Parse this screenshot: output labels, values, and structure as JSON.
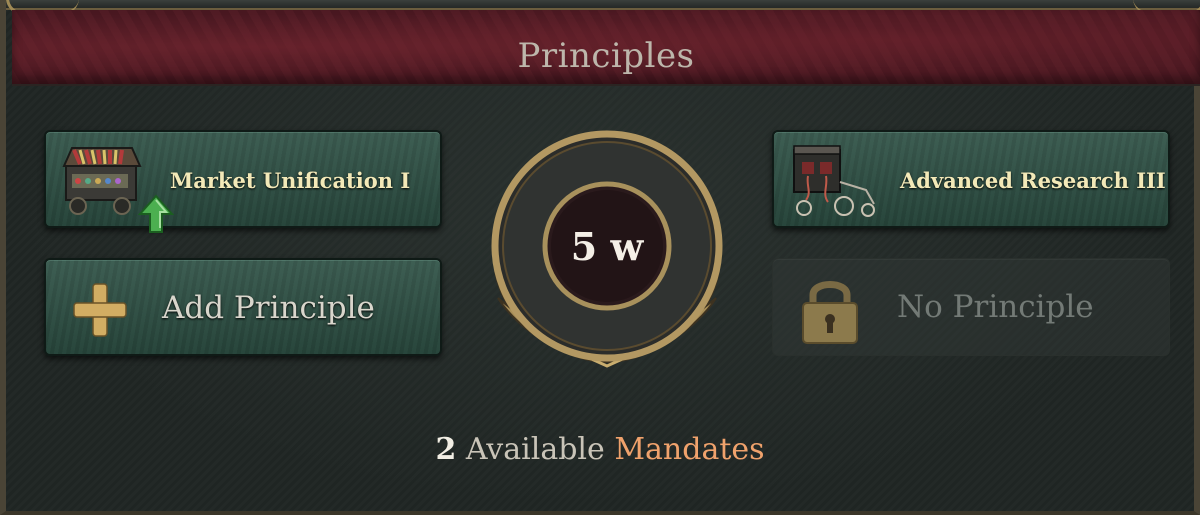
{
  "panel": {
    "title": "Principles"
  },
  "slots": {
    "market": {
      "label": "Market Unification I",
      "icon": "market-stall-icon",
      "badge": "upgrade-arrow-icon"
    },
    "research": {
      "label": "Advanced Research III",
      "icon": "research-cart-icon"
    },
    "add": {
      "label": "Add Principle",
      "icon": "plus-icon"
    },
    "locked": {
      "label": "No Principle",
      "icon": "lock-icon"
    }
  },
  "timer": {
    "value": "5 w"
  },
  "mandates": {
    "count": "2",
    "text": "Available",
    "word": "Mandates"
  },
  "colors": {
    "header": "#521c25",
    "slot_green": "#2f5246",
    "label_gold": "#f3e9b8",
    "mandate_accent": "#f0a26c",
    "plus_gold": "#d2ad63",
    "arrow_green": "#4caf50"
  }
}
